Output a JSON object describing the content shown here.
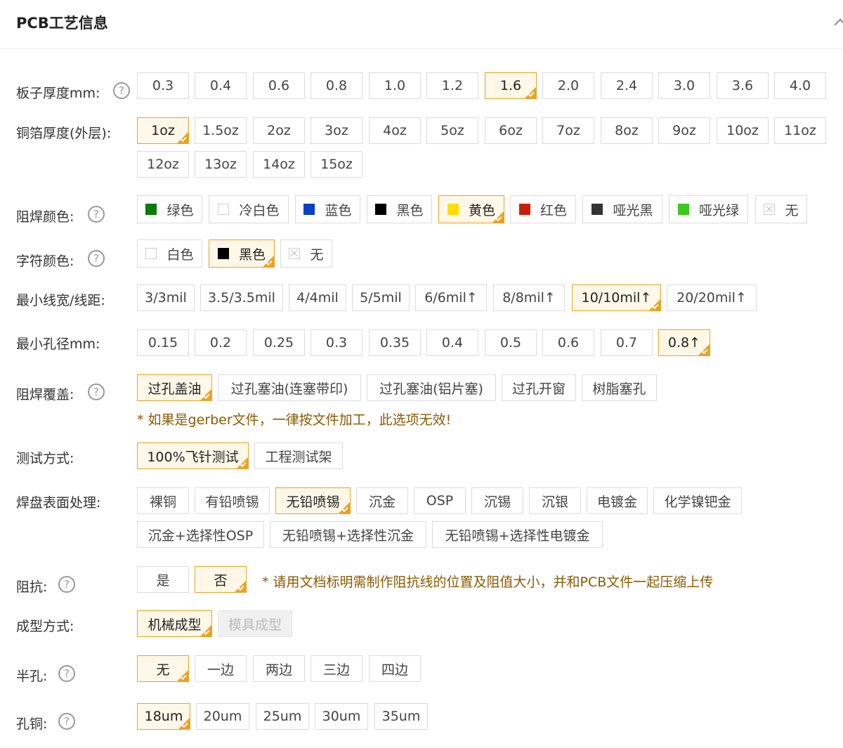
{
  "header": {
    "title": "PCB工艺信息"
  },
  "board_thickness": {
    "label": "板子厚度mm:",
    "options": [
      "0.3",
      "0.4",
      "0.6",
      "0.8",
      "1.0",
      "1.2",
      "1.6",
      "2.0",
      "2.4",
      "3.0",
      "3.6",
      "4.0"
    ],
    "selected": "1.6"
  },
  "copper_thickness": {
    "label": "铜箔厚度(外层):",
    "options": [
      "1oz",
      "1.5oz",
      "2oz",
      "3oz",
      "4oz",
      "5oz",
      "6oz",
      "7oz",
      "8oz",
      "9oz",
      "10oz",
      "11oz",
      "12oz",
      "13oz",
      "14oz",
      "15oz"
    ],
    "selected": "1oz"
  },
  "solder_mask_color": {
    "label": "阻焊颜色:",
    "options": [
      {
        "label": "绿色",
        "color": "#0a7a0a",
        "icon": "swatch"
      },
      {
        "label": "冷白色",
        "color": "#ffffff",
        "icon": "swatch-empty"
      },
      {
        "label": "蓝色",
        "color": "#0a3fc8",
        "icon": "swatch"
      },
      {
        "label": "黑色",
        "color": "#000000",
        "icon": "swatch"
      },
      {
        "label": "黄色",
        "color": "#ffdd00",
        "icon": "swatch"
      },
      {
        "label": "红色",
        "color": "#c81e0a",
        "icon": "swatch"
      },
      {
        "label": "哑光黑",
        "color": "#333333",
        "icon": "swatch"
      },
      {
        "label": "哑光绿",
        "color": "#3cc81e",
        "icon": "swatch"
      },
      {
        "label": "无",
        "color": "",
        "icon": "none-icon"
      }
    ],
    "selected": "黄色"
  },
  "silkscreen_color": {
    "label": "字符颜色:",
    "options": [
      {
        "label": "白色",
        "color": "#ffffff",
        "icon": "swatch-empty"
      },
      {
        "label": "黑色",
        "color": "#000000",
        "icon": "swatch"
      },
      {
        "label": "无",
        "color": "",
        "icon": "none-icon"
      }
    ],
    "selected": "黑色"
  },
  "min_trace": {
    "label": "最小线宽/线距:",
    "options": [
      "3/3mil",
      "3.5/3.5mil",
      "4/4mil",
      "5/5mil",
      "6/6mil↑",
      "8/8mil↑",
      "10/10mil↑",
      "20/20mil↑"
    ],
    "selected": "10/10mil↑"
  },
  "min_hole": {
    "label": "最小孔径mm:",
    "options": [
      "0.15",
      "0.2",
      "0.25",
      "0.3",
      "0.35",
      "0.4",
      "0.5",
      "0.6",
      "0.7",
      "0.8↑"
    ],
    "selected": "0.8↑"
  },
  "via_cover": {
    "label": "阻焊覆盖:",
    "options": [
      "过孔盖油",
      "过孔塞油(连塞带印)",
      "过孔塞油(铝片塞)",
      "过孔开窗",
      "树脂塞孔"
    ],
    "selected": "过孔盖油",
    "note": "* 如果是gerber文件，一律按文件加工，此选项无效!"
  },
  "test_method": {
    "label": "测试方式:",
    "options": [
      "100%飞针测试",
      "工程测试架"
    ],
    "selected": "100%飞针测试"
  },
  "surface_finish": {
    "label": "焊盘表面处理:",
    "options": [
      "裸铜",
      "有铅喷锡",
      "无铅喷锡",
      "沉金",
      "OSP",
      "沉锡",
      "沉银",
      "电镀金",
      "化学镍钯金",
      "沉金+选择性OSP",
      "无铅喷锡+选择性沉金",
      "无铅喷锡+选择性电镀金"
    ],
    "selected": "无铅喷锡"
  },
  "impedance": {
    "label": "阻抗:",
    "options": [
      "是",
      "否"
    ],
    "selected": "否",
    "note": "* 请用文档标明需制作阻抗线的位置及阻值大小，并和PCB文件一起压缩上传"
  },
  "forming": {
    "label": "成型方式:",
    "options": [
      "机械成型",
      "模具成型"
    ],
    "selected": "机械成型",
    "disabled": "模具成型"
  },
  "half_hole": {
    "label": "半孔:",
    "options": [
      "无",
      "一边",
      "两边",
      "三边",
      "四边"
    ],
    "selected": "无"
  },
  "hole_copper": {
    "label": "孔铜:",
    "options": [
      "18um",
      "20um",
      "25um",
      "30um",
      "35um"
    ],
    "selected": "18um"
  }
}
